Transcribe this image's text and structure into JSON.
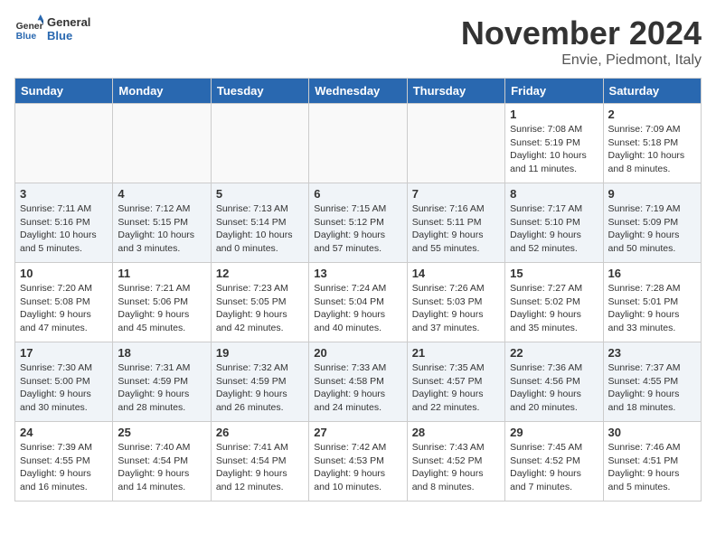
{
  "logo": {
    "text_general": "General",
    "text_blue": "Blue"
  },
  "title": "November 2024",
  "location": "Envie, Piedmont, Italy",
  "weekdays": [
    "Sunday",
    "Monday",
    "Tuesday",
    "Wednesday",
    "Thursday",
    "Friday",
    "Saturday"
  ],
  "weeks": [
    [
      {
        "day": "",
        "info": ""
      },
      {
        "day": "",
        "info": ""
      },
      {
        "day": "",
        "info": ""
      },
      {
        "day": "",
        "info": ""
      },
      {
        "day": "",
        "info": ""
      },
      {
        "day": "1",
        "info": "Sunrise: 7:08 AM\nSunset: 5:19 PM\nDaylight: 10 hours and 11 minutes."
      },
      {
        "day": "2",
        "info": "Sunrise: 7:09 AM\nSunset: 5:18 PM\nDaylight: 10 hours and 8 minutes."
      }
    ],
    [
      {
        "day": "3",
        "info": "Sunrise: 7:11 AM\nSunset: 5:16 PM\nDaylight: 10 hours and 5 minutes."
      },
      {
        "day": "4",
        "info": "Sunrise: 7:12 AM\nSunset: 5:15 PM\nDaylight: 10 hours and 3 minutes."
      },
      {
        "day": "5",
        "info": "Sunrise: 7:13 AM\nSunset: 5:14 PM\nDaylight: 10 hours and 0 minutes."
      },
      {
        "day": "6",
        "info": "Sunrise: 7:15 AM\nSunset: 5:12 PM\nDaylight: 9 hours and 57 minutes."
      },
      {
        "day": "7",
        "info": "Sunrise: 7:16 AM\nSunset: 5:11 PM\nDaylight: 9 hours and 55 minutes."
      },
      {
        "day": "8",
        "info": "Sunrise: 7:17 AM\nSunset: 5:10 PM\nDaylight: 9 hours and 52 minutes."
      },
      {
        "day": "9",
        "info": "Sunrise: 7:19 AM\nSunset: 5:09 PM\nDaylight: 9 hours and 50 minutes."
      }
    ],
    [
      {
        "day": "10",
        "info": "Sunrise: 7:20 AM\nSunset: 5:08 PM\nDaylight: 9 hours and 47 minutes."
      },
      {
        "day": "11",
        "info": "Sunrise: 7:21 AM\nSunset: 5:06 PM\nDaylight: 9 hours and 45 minutes."
      },
      {
        "day": "12",
        "info": "Sunrise: 7:23 AM\nSunset: 5:05 PM\nDaylight: 9 hours and 42 minutes."
      },
      {
        "day": "13",
        "info": "Sunrise: 7:24 AM\nSunset: 5:04 PM\nDaylight: 9 hours and 40 minutes."
      },
      {
        "day": "14",
        "info": "Sunrise: 7:26 AM\nSunset: 5:03 PM\nDaylight: 9 hours and 37 minutes."
      },
      {
        "day": "15",
        "info": "Sunrise: 7:27 AM\nSunset: 5:02 PM\nDaylight: 9 hours and 35 minutes."
      },
      {
        "day": "16",
        "info": "Sunrise: 7:28 AM\nSunset: 5:01 PM\nDaylight: 9 hours and 33 minutes."
      }
    ],
    [
      {
        "day": "17",
        "info": "Sunrise: 7:30 AM\nSunset: 5:00 PM\nDaylight: 9 hours and 30 minutes."
      },
      {
        "day": "18",
        "info": "Sunrise: 7:31 AM\nSunset: 4:59 PM\nDaylight: 9 hours and 28 minutes."
      },
      {
        "day": "19",
        "info": "Sunrise: 7:32 AM\nSunset: 4:59 PM\nDaylight: 9 hours and 26 minutes."
      },
      {
        "day": "20",
        "info": "Sunrise: 7:33 AM\nSunset: 4:58 PM\nDaylight: 9 hours and 24 minutes."
      },
      {
        "day": "21",
        "info": "Sunrise: 7:35 AM\nSunset: 4:57 PM\nDaylight: 9 hours and 22 minutes."
      },
      {
        "day": "22",
        "info": "Sunrise: 7:36 AM\nSunset: 4:56 PM\nDaylight: 9 hours and 20 minutes."
      },
      {
        "day": "23",
        "info": "Sunrise: 7:37 AM\nSunset: 4:55 PM\nDaylight: 9 hours and 18 minutes."
      }
    ],
    [
      {
        "day": "24",
        "info": "Sunrise: 7:39 AM\nSunset: 4:55 PM\nDaylight: 9 hours and 16 minutes."
      },
      {
        "day": "25",
        "info": "Sunrise: 7:40 AM\nSunset: 4:54 PM\nDaylight: 9 hours and 14 minutes."
      },
      {
        "day": "26",
        "info": "Sunrise: 7:41 AM\nSunset: 4:54 PM\nDaylight: 9 hours and 12 minutes."
      },
      {
        "day": "27",
        "info": "Sunrise: 7:42 AM\nSunset: 4:53 PM\nDaylight: 9 hours and 10 minutes."
      },
      {
        "day": "28",
        "info": "Sunrise: 7:43 AM\nSunset: 4:52 PM\nDaylight: 9 hours and 8 minutes."
      },
      {
        "day": "29",
        "info": "Sunrise: 7:45 AM\nSunset: 4:52 PM\nDaylight: 9 hours and 7 minutes."
      },
      {
        "day": "30",
        "info": "Sunrise: 7:46 AM\nSunset: 4:51 PM\nDaylight: 9 hours and 5 minutes."
      }
    ]
  ]
}
